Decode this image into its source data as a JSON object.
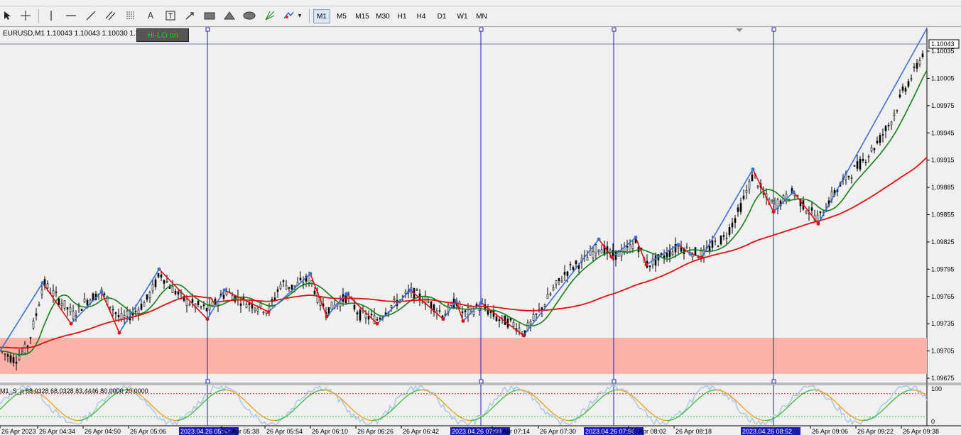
{
  "toolbar": {
    "timeframes": [
      "M1",
      "M5",
      "M15",
      "M30",
      "H1",
      "H4",
      "D1",
      "W1",
      "MN"
    ],
    "active_timeframe": "M1",
    "text_tool_label": "A",
    "dropdown_arrow": "▾"
  },
  "chart": {
    "symbol_info": "EURUSD,M1  1.10043 1.10043 1.10030 1.10",
    "hilo_button": "Hi-LO on",
    "current_price": "1.10043",
    "price_labels": [
      "1.10035",
      "1.10005",
      "1.09975",
      "1.09945",
      "1.09915",
      "1.09885",
      "1.09855",
      "1.09825",
      "1.09795",
      "1.09765",
      "1.09735",
      "1.09705",
      "1.09675"
    ],
    "time_labels": [
      "26 Apr 2023",
      "26 Apr 04:34",
      "26 Apr 04:50",
      "26 Apr 05:06",
      "2023.04.26 05:33",
      "26 Apr 05:38",
      "26 Apr 05:54",
      "26 Apr 06:10",
      "26 Apr 06:26",
      "26 Apr 06:42",
      "2023.04.26 07:09",
      "26 Apr 07:14",
      "26 Apr 07:30",
      "2023.04.26 07:56",
      "26 Apr 08:02",
      "26 Apr 08:18",
      "2023.04.26 08:52",
      "26 Apr 09:06",
      "26 Apr 09:22",
      "26 Apr 09:38"
    ],
    "highlighted_time_labels": [
      4,
      10,
      13,
      16
    ],
    "indicator_label": "M1_S_p 68.0328 68.0328 83.4446 80.0000 20.0000",
    "indicator_levels": [
      "100",
      "0"
    ],
    "colors": {
      "background": "#f0f0f0",
      "zone": "#fbb3a8",
      "ma_slow": "#e01010",
      "ma_fast": "#128012",
      "zigzag_up": "#3a70d8",
      "zigzag_down": "#e01010",
      "vline": "#1f1fa8",
      "osc_orange": "#f0a020",
      "osc_green": "#40c040",
      "osc_blue": "#a8c4e8",
      "level_red": "#cc2020",
      "level_green": "#40c040"
    }
  }
}
